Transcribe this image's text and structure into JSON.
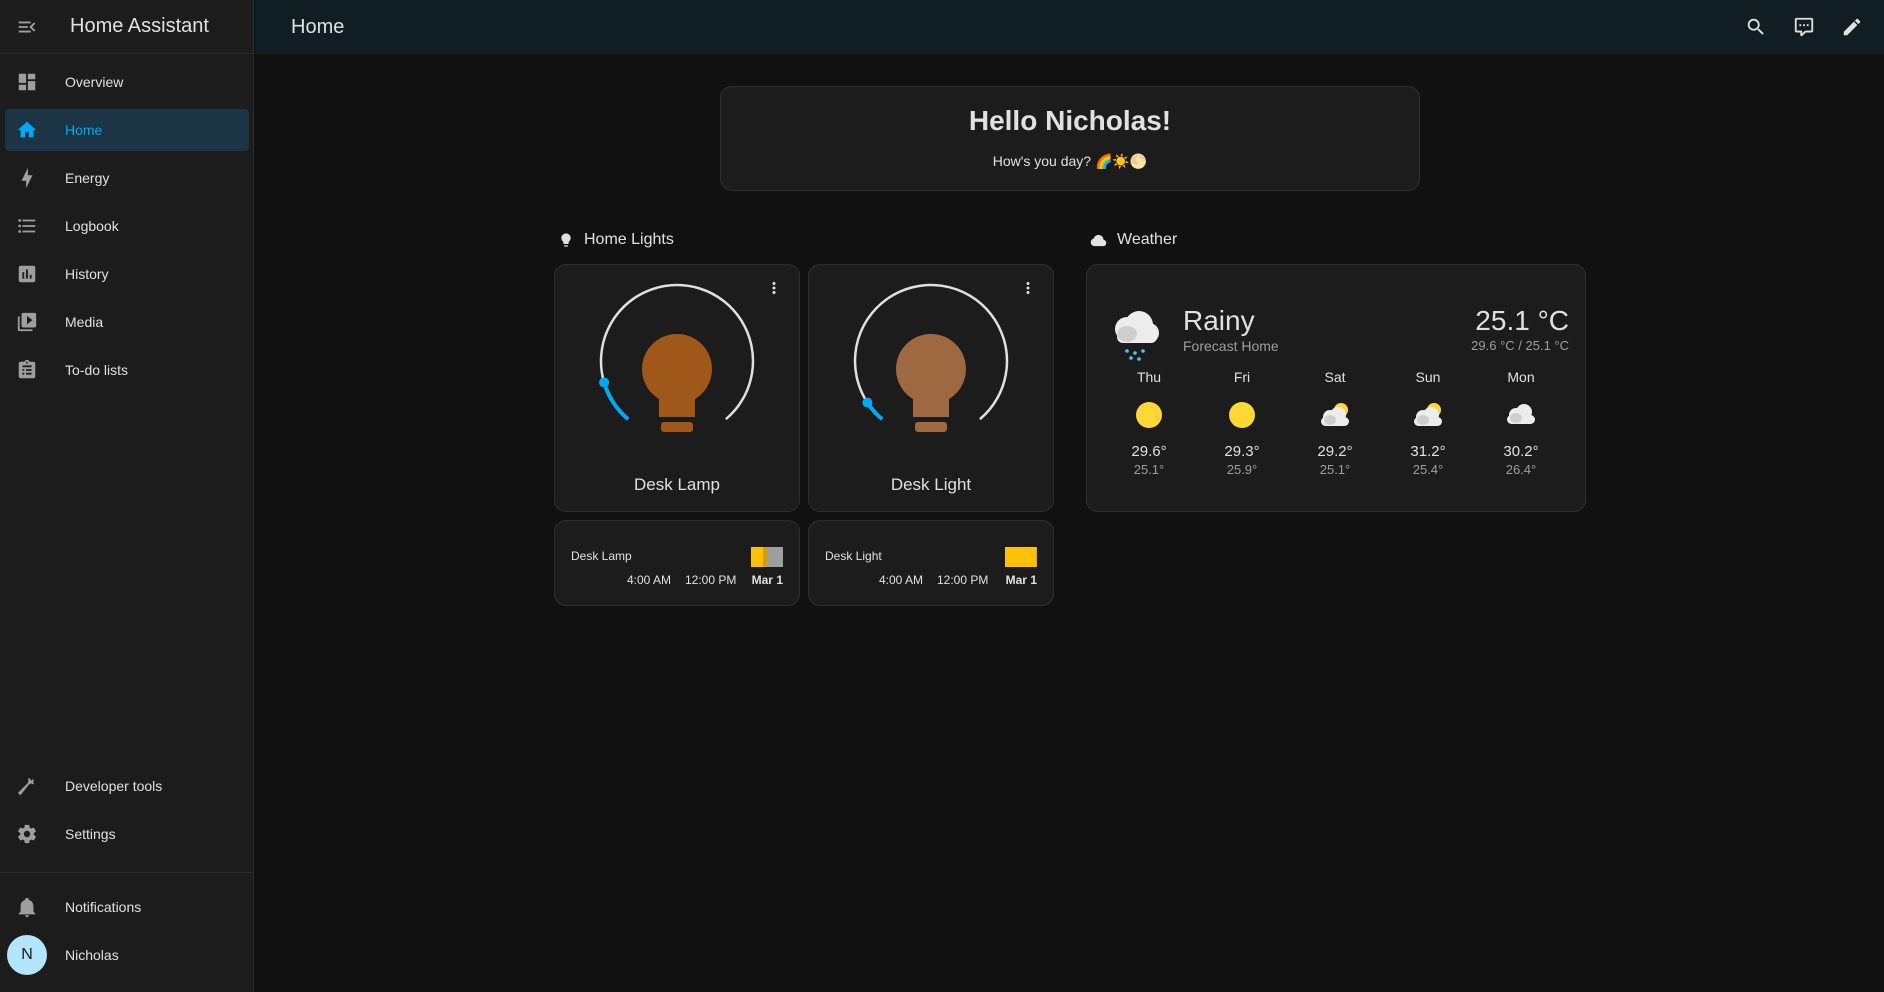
{
  "app": {
    "title": "Home Assistant"
  },
  "sidebar": {
    "items": [
      {
        "label": "Overview",
        "icon": "dashboard-icon"
      },
      {
        "label": "Home",
        "icon": "home-icon",
        "active": true
      },
      {
        "label": "Energy",
        "icon": "lightning-icon"
      },
      {
        "label": "Logbook",
        "icon": "list-icon"
      },
      {
        "label": "History",
        "icon": "chart-icon"
      },
      {
        "label": "Media",
        "icon": "media-icon"
      },
      {
        "label": "To-do lists",
        "icon": "clipboard-icon"
      }
    ],
    "bottom_items": [
      {
        "label": "Developer tools",
        "icon": "hammer-icon"
      },
      {
        "label": "Settings",
        "icon": "gear-icon"
      }
    ],
    "notifications_label": "Notifications",
    "user": {
      "name": "Nicholas",
      "initial": "N"
    }
  },
  "header": {
    "title": "Home"
  },
  "greeting": {
    "title": "Hello Nicholas!",
    "subtitle": "How's you day? 🌈☀️🌕"
  },
  "lights_section": {
    "title": "Home Lights"
  },
  "lights": [
    {
      "name": "Desk Lamp",
      "brightness_fraction": 0.12,
      "color": "#a0571a"
    },
    {
      "name": "Desk Light",
      "brightness_fraction": 0.06,
      "color": "#9e6840"
    }
  ],
  "history": [
    {
      "name": "Desk Lamp",
      "time1": "4:00 AM",
      "time2": "12:00 PM",
      "date": "Mar 1"
    },
    {
      "name": "Desk Light",
      "time1": "4:00 AM",
      "time2": "12:00 PM",
      "date": "Mar 1"
    }
  ],
  "weather_section": {
    "title": "Weather"
  },
  "weather": {
    "condition": "Rainy",
    "name": "Forecast Home",
    "temperature": "25.1 °C",
    "range": "29.6 °C / 25.1 °C",
    "forecast": [
      {
        "day": "Thu",
        "icon": "sunny-icon",
        "high": "29.6°",
        "low": "25.1°"
      },
      {
        "day": "Fri",
        "icon": "sunny-icon",
        "high": "29.3°",
        "low": "25.9°"
      },
      {
        "day": "Sat",
        "icon": "partly-cloudy-icon",
        "high": "29.2°",
        "low": "25.1°"
      },
      {
        "day": "Sun",
        "icon": "partly-cloudy-icon",
        "high": "31.2°",
        "low": "25.4°"
      },
      {
        "day": "Mon",
        "icon": "cloudy-icon",
        "high": "30.2°",
        "low": "26.4°"
      }
    ]
  },
  "colors": {
    "accent": "#03a9f4",
    "sun": "#fdd835",
    "bar_on": "#ffc107",
    "bar_off": "#9e9e9e"
  }
}
